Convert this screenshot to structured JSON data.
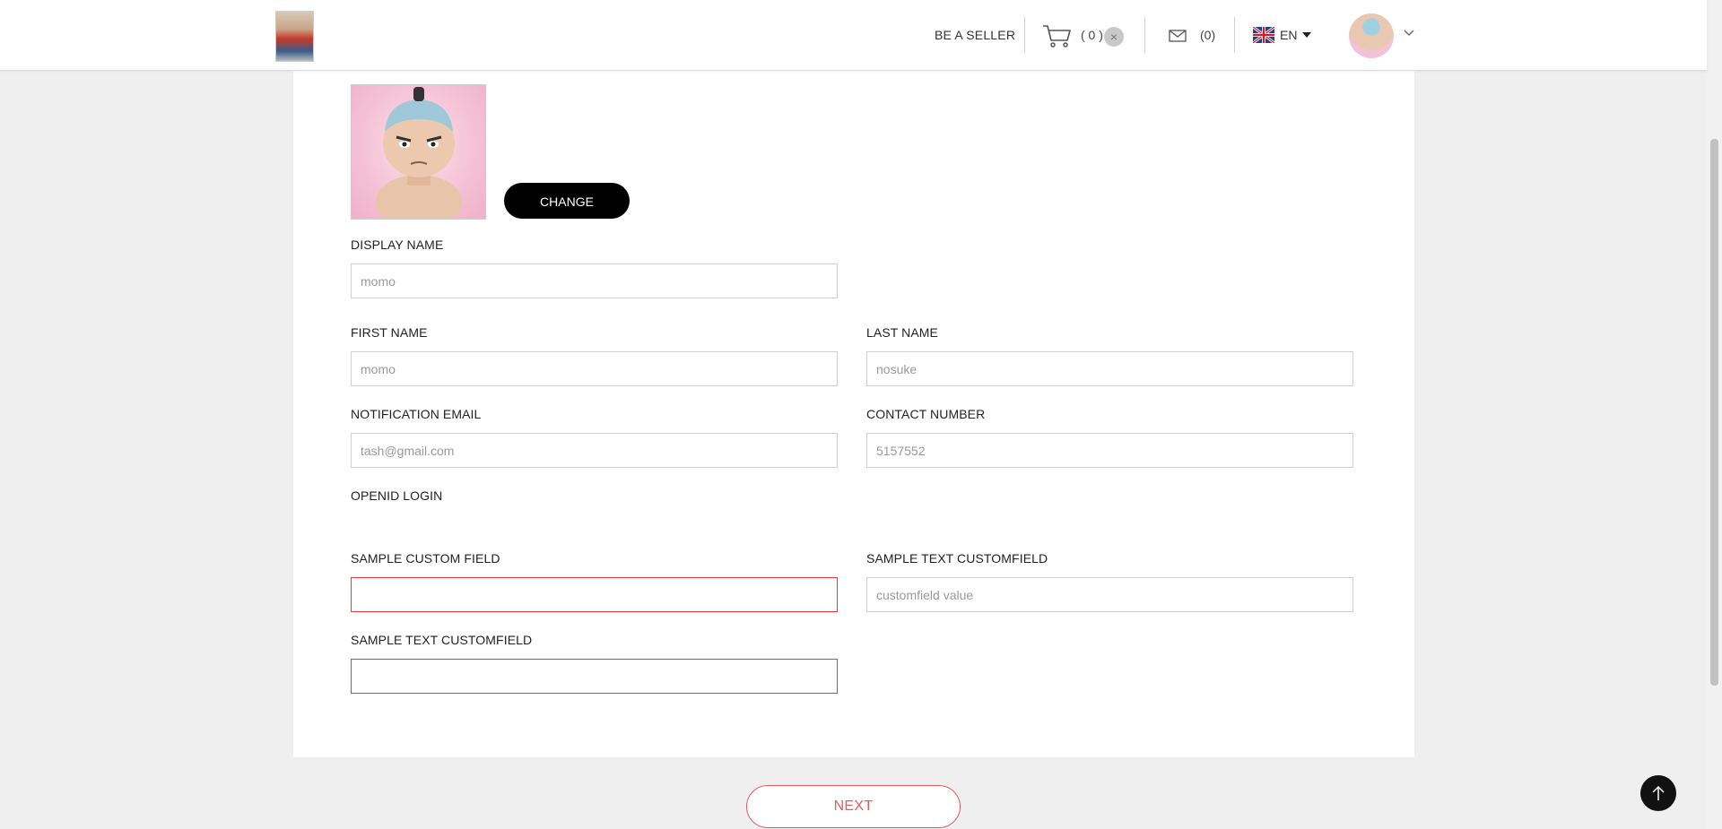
{
  "header": {
    "logo_icon": "doll-logo-icon",
    "be_seller": "BE A SELLER",
    "cart_count": "( 0 )",
    "cart_clear_glyph": "×",
    "mail_count": "(0)",
    "language": "EN"
  },
  "profile": {
    "change_label": "CHANGE"
  },
  "form": {
    "display_name": {
      "label": "DISPLAY NAME",
      "placeholder": "momo"
    },
    "first_name": {
      "label": "FIRST NAME",
      "placeholder": "momo"
    },
    "last_name": {
      "label": "LAST NAME",
      "placeholder": "nosuke"
    },
    "notification_email": {
      "label": "NOTIFICATION EMAIL",
      "placeholder": "tash@gmail.com"
    },
    "contact_number": {
      "label": "CONTACT NUMBER",
      "placeholder": "5157552"
    },
    "openid_login": {
      "label": "OPENID LOGIN"
    },
    "sample_custom_field": {
      "label": "SAMPLE CUSTOM FIELD",
      "placeholder": ""
    },
    "sample_text_customfield_1": {
      "label": "SAMPLE TEXT CUSTOMFIELD",
      "placeholder": "customfield value"
    },
    "sample_text_customfield_2": {
      "label": "SAMPLE TEXT CUSTOMFIELD",
      "placeholder": ""
    }
  },
  "actions": {
    "next_label": "NEXT"
  },
  "colors": {
    "error": "#e53935",
    "next": "#e35b5b",
    "background": "#efefef"
  }
}
